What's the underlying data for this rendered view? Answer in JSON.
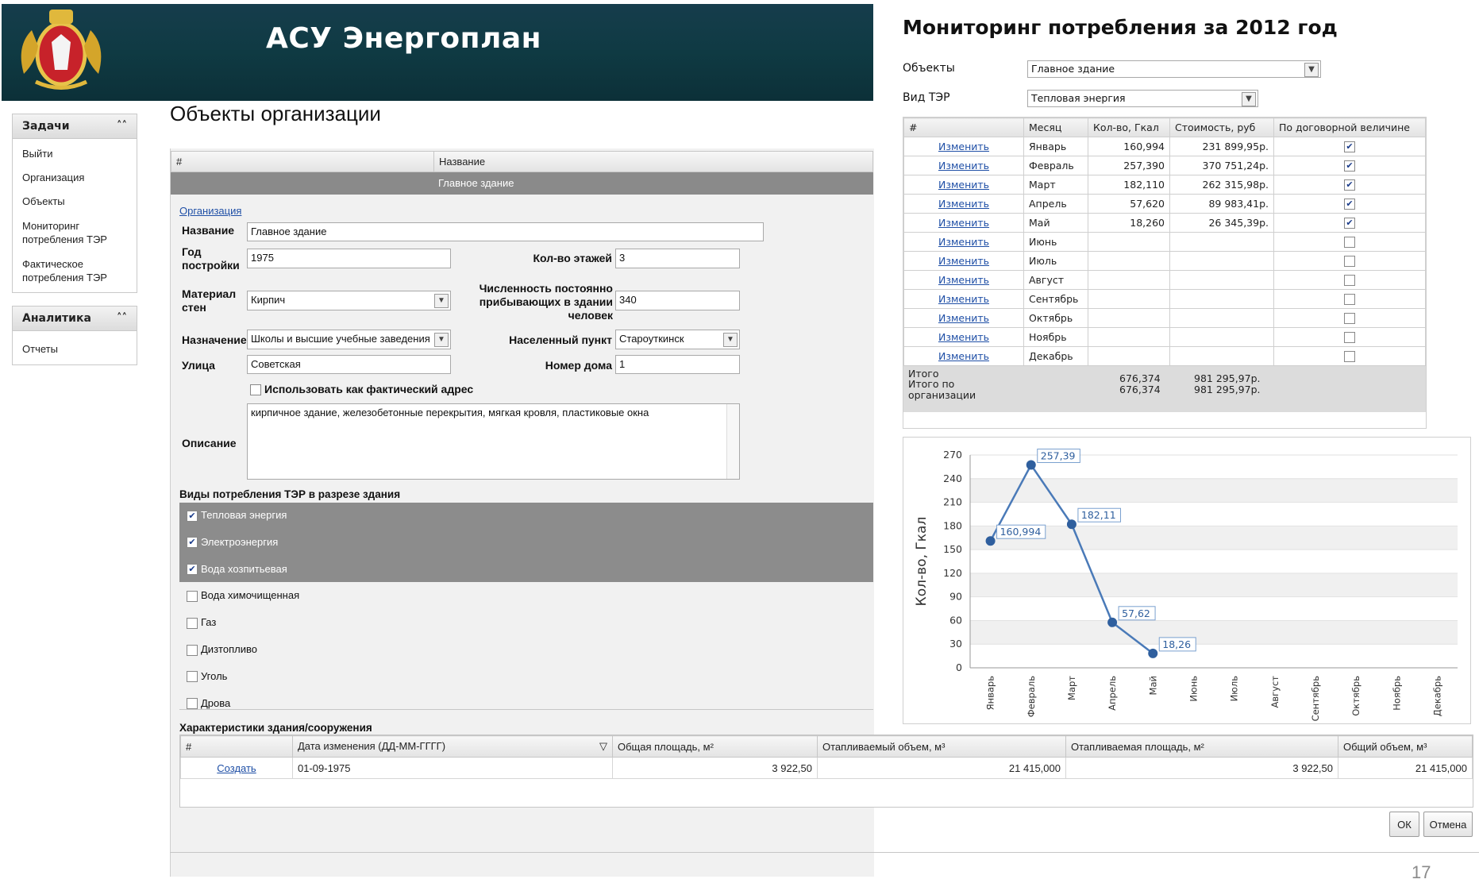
{
  "header": {
    "title": "АСУ Энергоплан"
  },
  "sidebar": {
    "tasks_title": "Задачи",
    "tasks": [
      "Выйти",
      "Организация",
      "Объекты",
      "Мониторинг потребления ТЭР",
      "Фактическое потребления ТЭР"
    ],
    "analytics_title": "Аналитика",
    "analytics": [
      "Отчеты"
    ],
    "collapse_icon": "double-chevron-up-icon"
  },
  "objects": {
    "title": "Объекты организации",
    "grid": {
      "col_num": "#",
      "col_name": "Название",
      "selected_row": "Главное здание"
    },
    "org_link": "Организация",
    "form": {
      "name_label": "Название",
      "name_value": "Главное здание",
      "year_label": "Год постройки",
      "year_value": "1975",
      "floors_label": "Кол-во этажей",
      "floors_value": "3",
      "material_label": "Материал стен",
      "material_value": "Кирпич",
      "people_label": "Численность постоянно прибывающих в здании человек",
      "people_value": "340",
      "purpose_label": "Назначение",
      "purpose_value": "Школы и высшие учебные заведения",
      "locality_label": "Населенный пункт",
      "locality_value": "Староуткинск",
      "street_label": "Улица",
      "street_value": "Советская",
      "house_label": "Номер дома",
      "house_value": "1",
      "actual_address_label": "Использовать как фактический адрес",
      "description_label": "Описание",
      "description_value": "кирпичное здание, железобетонные перекрытия, мягкая кровля, пластиковые окна"
    },
    "consumption_title": "Виды потребления ТЭР в разрезе здания",
    "consumption": [
      {
        "label": "Тепловая энергия",
        "checked": true
      },
      {
        "label": "Электроэнергия",
        "checked": true
      },
      {
        "label": "Вода хозпитьевая",
        "checked": true
      },
      {
        "label": "Вода химочищенная",
        "checked": false
      },
      {
        "label": "Газ",
        "checked": false
      },
      {
        "label": "Дизтопливо",
        "checked": false
      },
      {
        "label": "Уголь",
        "checked": false
      },
      {
        "label": "Дрова",
        "checked": false
      }
    ],
    "characteristics": {
      "title": "Характеристики здания/сооружения",
      "headers": [
        "#",
        "Дата изменения (ДД-ММ-ГГГГ)",
        "Общая площадь, м²",
        "Отапливаемый объем, м³",
        "Отапливаемая площадь, м²",
        "Общий объем, м³"
      ],
      "row": {
        "action": "Создать",
        "date": "01-09-1975",
        "total_area": "3 922,50",
        "heated_volume": "21 415,000",
        "heated_area": "3 922,50",
        "total_volume": "21 415,000"
      }
    },
    "ok": "ОК",
    "cancel": "Отмена"
  },
  "monitoring": {
    "title": "Мониторинг потребления за 2012 год",
    "objects_label": "Объекты",
    "objects_value": "Главное здание",
    "ter_label": "Вид ТЭР",
    "ter_value": "Тепловая энергия",
    "headers": [
      "#",
      "Месяц",
      "Кол-во, Гкал",
      "Стоимость, руб",
      "По договорной величине"
    ],
    "rows": [
      {
        "action": "Изменить",
        "month": "Январь",
        "qty": "160,994",
        "cost": "231 899,95р.",
        "contract": true
      },
      {
        "action": "Изменить",
        "month": "Февраль",
        "qty": "257,390",
        "cost": "370 751,24р.",
        "contract": true
      },
      {
        "action": "Изменить",
        "month": "Март",
        "qty": "182,110",
        "cost": "262 315,98р.",
        "contract": true
      },
      {
        "action": "Изменить",
        "month": "Апрель",
        "qty": "57,620",
        "cost": "89 983,41р.",
        "contract": true
      },
      {
        "action": "Изменить",
        "month": "Май",
        "qty": "18,260",
        "cost": "26 345,39р.",
        "contract": true
      },
      {
        "action": "Изменить",
        "month": "Июнь",
        "qty": "",
        "cost": "",
        "contract": false
      },
      {
        "action": "Изменить",
        "month": "Июль",
        "qty": "",
        "cost": "",
        "contract": false
      },
      {
        "action": "Изменить",
        "month": "Август",
        "qty": "",
        "cost": "",
        "contract": false
      },
      {
        "action": "Изменить",
        "month": "Сентябрь",
        "qty": "",
        "cost": "",
        "contract": false
      },
      {
        "action": "Изменить",
        "month": "Октябрь",
        "qty": "",
        "cost": "",
        "contract": false
      },
      {
        "action": "Изменить",
        "month": "Ноябрь",
        "qty": "",
        "cost": "",
        "contract": false
      },
      {
        "action": "Изменить",
        "month": "Декабрь",
        "qty": "",
        "cost": "",
        "contract": false
      }
    ],
    "total_label": "Итого",
    "total_qty": "676,374",
    "total_cost": "981 295,97р.",
    "org_total_label": "Итого по организации",
    "org_total_qty": "676,374",
    "org_total_cost": "981 295,97р."
  },
  "chart_data": {
    "type": "line",
    "categories": [
      "Январь",
      "Февраль",
      "Март",
      "Апрель",
      "Май",
      "Июнь",
      "Июль",
      "Август",
      "Сентябрь",
      "Октябрь",
      "Ноябрь",
      "Декабрь"
    ],
    "values": [
      160.994,
      257.39,
      182.11,
      57.62,
      18.26,
      null,
      null,
      null,
      null,
      null,
      null,
      null
    ],
    "data_labels": [
      "160,994",
      "257,39",
      "182,11",
      "57,62",
      "18,26"
    ],
    "ylabel": "Кол-во, Гкал",
    "ylim": [
      0,
      270
    ],
    "yticks": [
      0,
      30,
      60,
      90,
      120,
      150,
      180,
      210,
      240,
      270
    ],
    "grid": true,
    "color": "#4a7ab8"
  },
  "page_number": "17"
}
